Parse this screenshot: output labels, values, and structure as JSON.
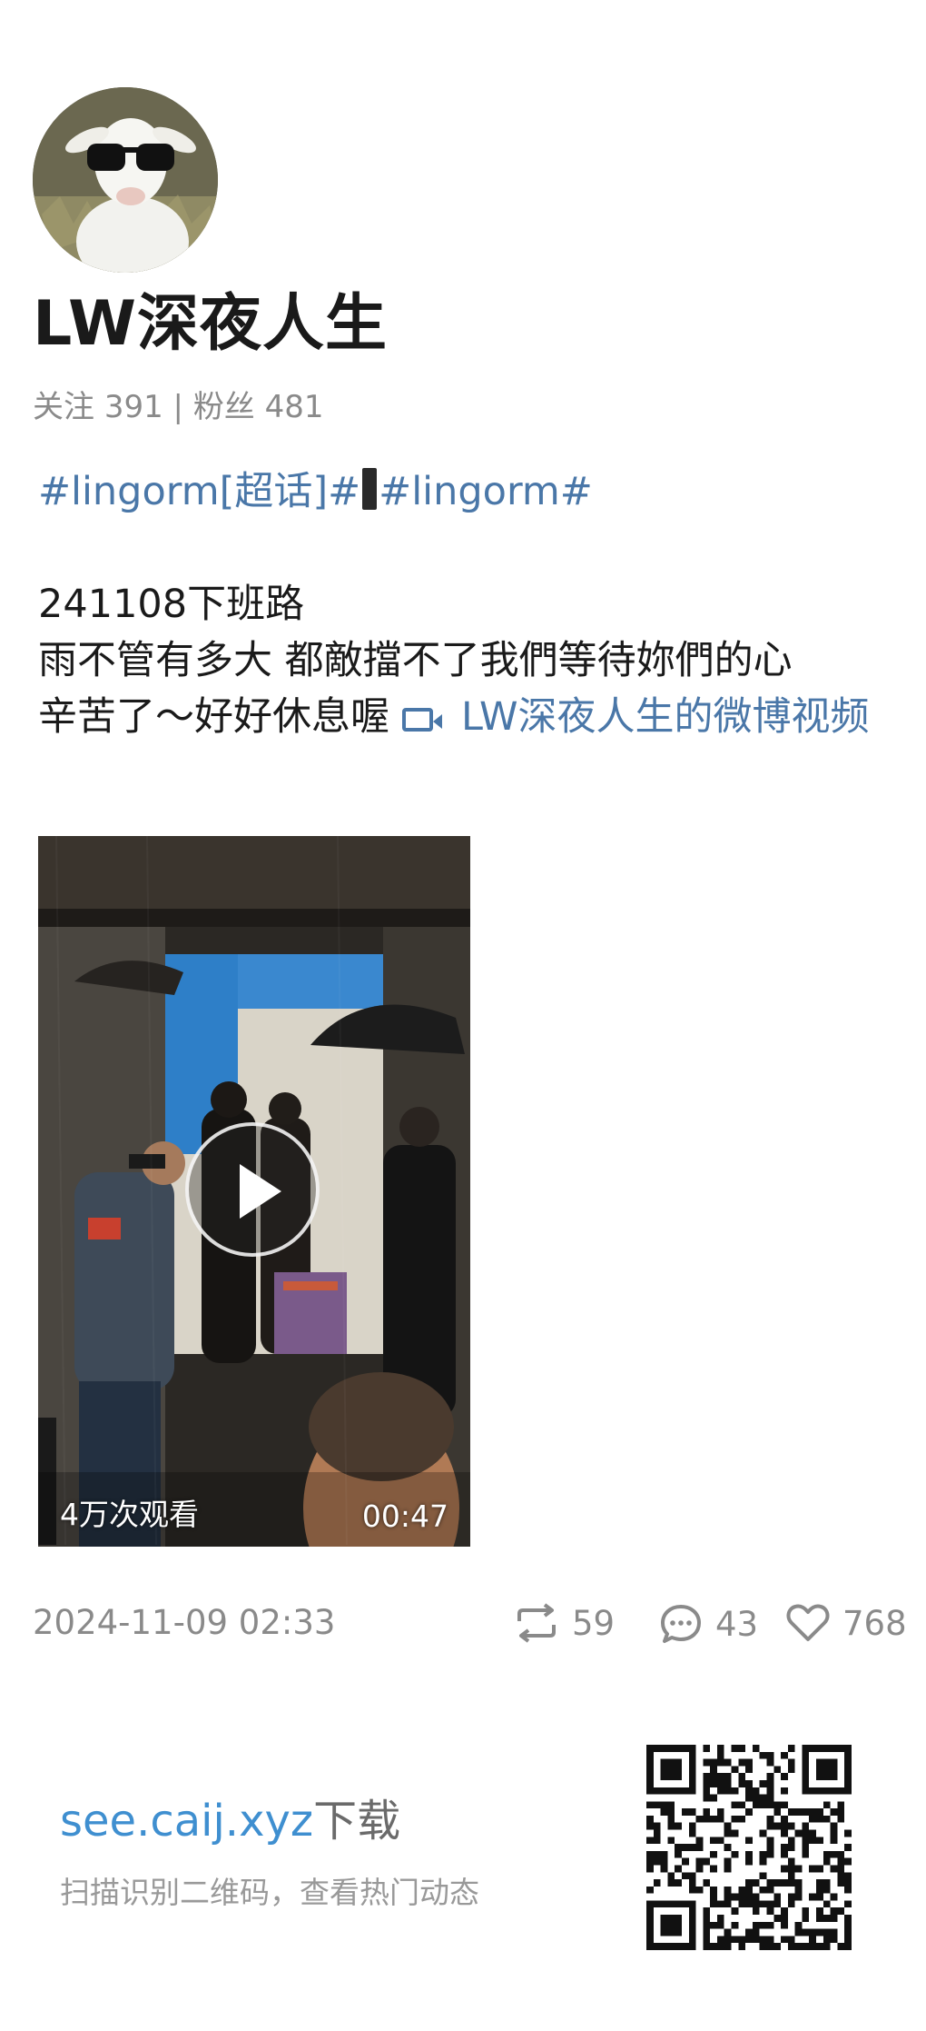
{
  "profile": {
    "username": "LW深夜人生",
    "following_label": "关注",
    "following_count": "391",
    "separator": "|",
    "followers_label": "粉丝",
    "followers_count": "481"
  },
  "post": {
    "topic_1": "#lingorm[超话]#",
    "topic_2": "#lingorm#",
    "line_1": "241108下班路",
    "line_2": "雨不管有多大 都敵擋不了我們等待妳們的心",
    "line_3": "辛苦了～好好休息喔 ",
    "video_link": "LW深夜人生的微博视频"
  },
  "video": {
    "views": "4万次观看",
    "duration": "00:47"
  },
  "meta": {
    "timestamp": "2024-11-09 02:33",
    "reposts": "59",
    "comments": "43",
    "likes": "768"
  },
  "footer": {
    "domain": "see.caij.xyz",
    "download_label": "下载",
    "subtitle": "扫描识别二维码，查看热门动态"
  },
  "colors": {
    "link": "#4a77a8",
    "footer_domain": "#3f8fd0",
    "muted": "#8a8a8a"
  },
  "icons": [
    "goat-avatar",
    "video-link-icon",
    "play-icon",
    "repost-icon",
    "comment-icon",
    "heart-icon",
    "qr-code"
  ]
}
